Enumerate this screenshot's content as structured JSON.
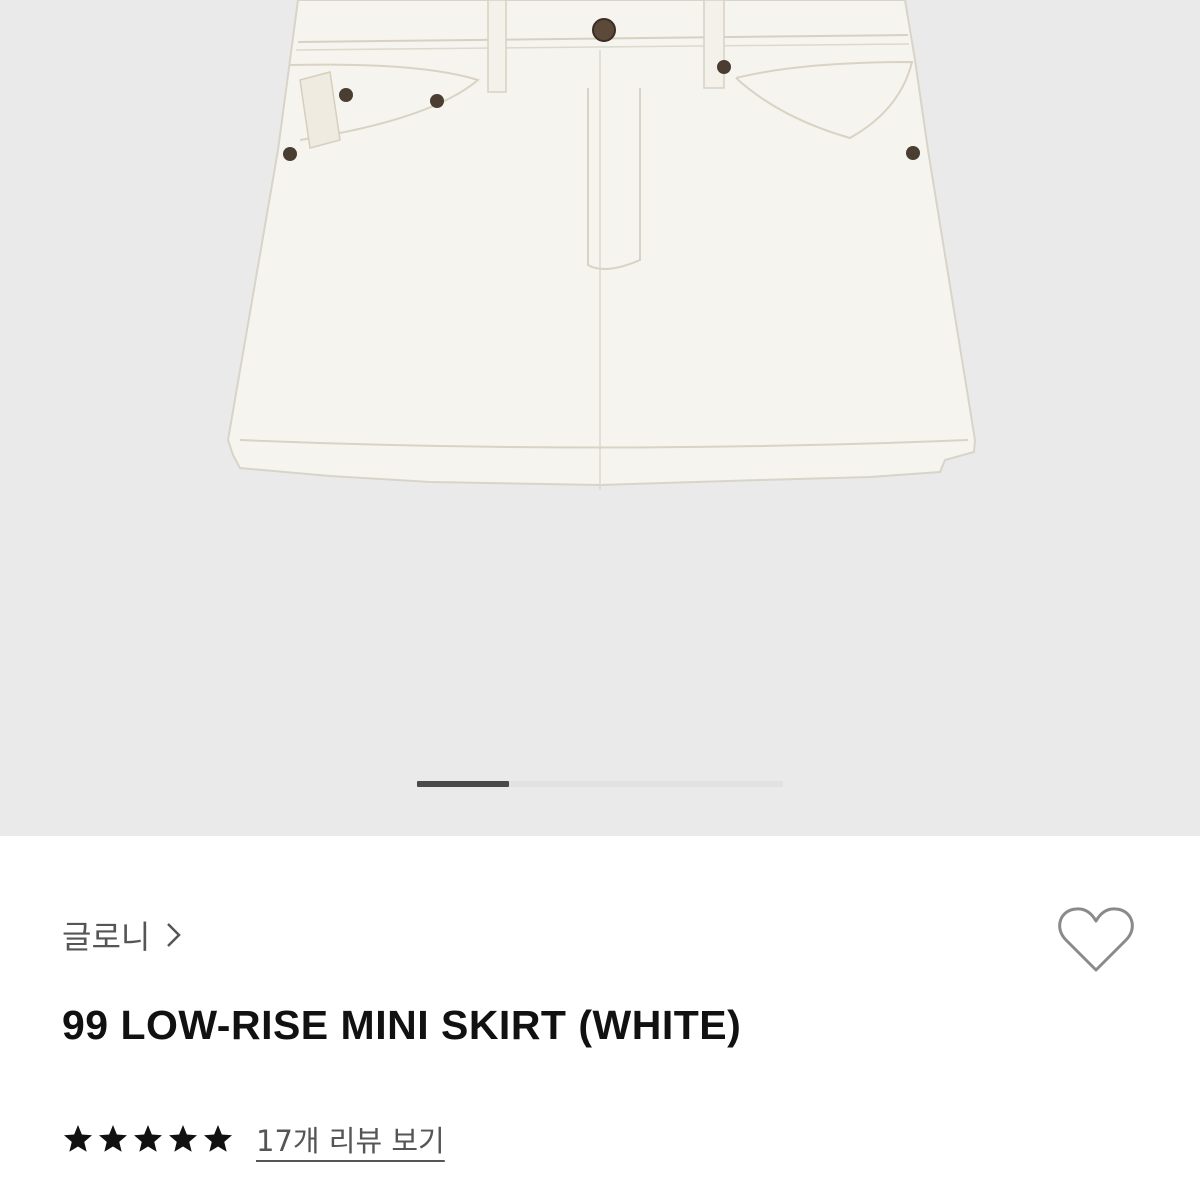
{
  "gallery": {
    "image_alt": "99 LOW-RISE MINI SKIRT (WHITE)",
    "slide_index": 1,
    "slide_count": 4
  },
  "brand": {
    "name": "글로니",
    "chevron_icon": "chevron-right-icon"
  },
  "wishlist": {
    "icon": "heart-outline-icon"
  },
  "product": {
    "title": "99 LOW-RISE MINI SKIRT (WHITE)"
  },
  "rating": {
    "stars": 5,
    "max_stars": 5,
    "star_icon": "star-icon",
    "review_link": "17개 리뷰 보기"
  },
  "colors": {
    "gallery_bg": "#eaeaea",
    "indicator_active": "#4a4a4a",
    "title_text": "#111111",
    "secondary_text": "#555555"
  }
}
